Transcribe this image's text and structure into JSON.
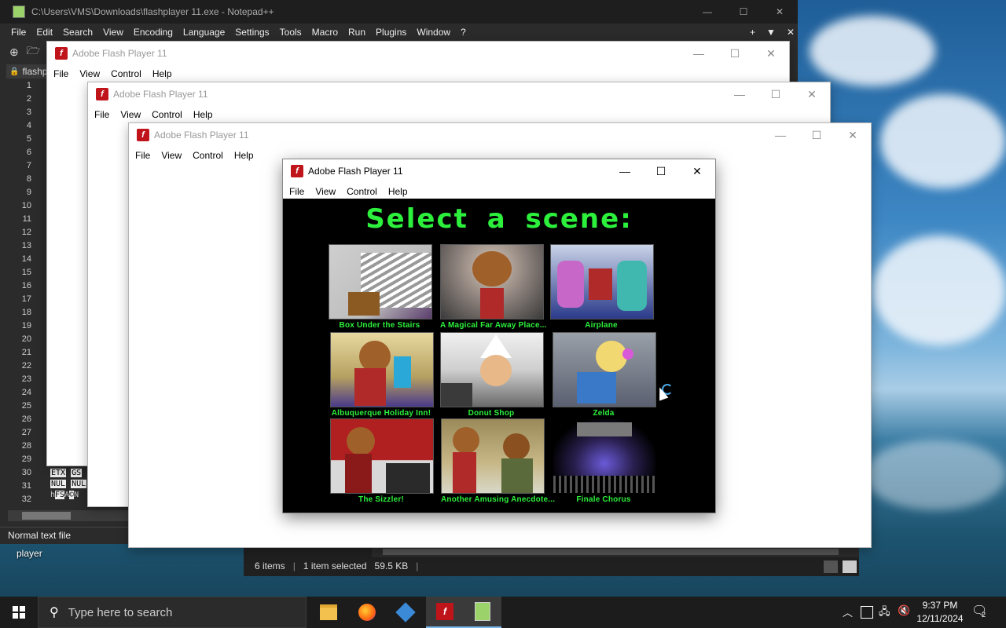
{
  "notepad": {
    "title": "C:\\Users\\VMS\\Downloads\\flashplayer 11.exe - Notepad++",
    "menu": [
      "File",
      "Edit",
      "Search",
      "View",
      "Encoding",
      "Language",
      "Settings",
      "Tools",
      "Macro",
      "Run",
      "Plugins",
      "Window",
      "?"
    ],
    "menu_right": [
      "+",
      "▼",
      "✕"
    ],
    "tab_label": "flashp",
    "line_numbers": [
      "1",
      "2",
      "3",
      "4",
      "5",
      "6",
      "7",
      "8",
      "9",
      "10",
      "11",
      "12",
      "13",
      "14",
      "15",
      "16",
      "17",
      "18",
      "19",
      "20",
      "21",
      "22",
      "23",
      "24",
      "25",
      "26",
      "27",
      "28",
      "29",
      "30",
      "31",
      "32"
    ],
    "control_chars": [
      [
        "ETX",
        "GS"
      ],
      [
        "NUL",
        "NUL"
      ],
      [
        "h",
        "FS",
        "A",
        "©",
        "N"
      ]
    ],
    "status": "Normal text file"
  },
  "desktop_icon_label": "player",
  "flash_windows": [
    {
      "title": "Adobe Flash Player 11",
      "menu": [
        "File",
        "View",
        "Control",
        "Help"
      ]
    },
    {
      "title": "Adobe Flash Player 11",
      "menu": [
        "File",
        "View",
        "Control",
        "Help"
      ]
    },
    {
      "title": "Adobe Flash Player 11",
      "menu": [
        "File",
        "View",
        "Control",
        "Help"
      ]
    }
  ],
  "active_flash": {
    "title": "Adobe Flash Player 11",
    "menu": [
      "File",
      "View",
      "Control",
      "Help"
    ],
    "heading": "Select a scene:",
    "scenes": [
      {
        "label": "Box Under the Stairs"
      },
      {
        "label": "A Magical Far Away Place..."
      },
      {
        "label": "Airplane"
      },
      {
        "label": "Albuquerque Holiday Inn!"
      },
      {
        "label": "Donut Shop"
      },
      {
        "label": "Zelda"
      },
      {
        "label": "The Sizzler!"
      },
      {
        "label": "Another Amusing Anecdote..."
      },
      {
        "label": "Finale Chorus"
      }
    ]
  },
  "explorer_status": {
    "items": "6 items",
    "selected": "1 item selected",
    "size": "59.5 KB"
  },
  "taskbar": {
    "search_placeholder": "Type here to search",
    "time": "9:37 PM",
    "date": "12/11/2024",
    "notifications": "2"
  },
  "colors": {
    "flash_green": "#2cf03c",
    "flash_red": "#c0141b",
    "taskbar": "#1c1c1c"
  }
}
